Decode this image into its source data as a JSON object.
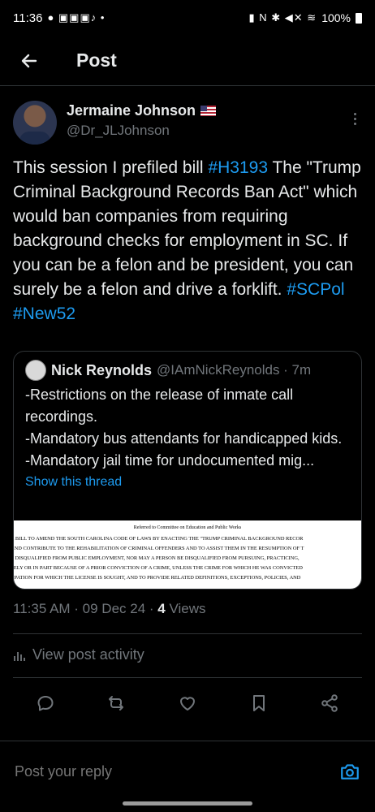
{
  "status_bar": {
    "time": "11:36",
    "notifications": "● ▣▣▣♪ •",
    "system_icons": "▮ N ✱ ◀✕ ≋",
    "battery": "100%"
  },
  "header": {
    "title": "Post"
  },
  "post": {
    "author_name": "Jermaine Johnson",
    "author_handle": "@Dr_JLJohnson",
    "text_part1": "This session I prefiled bill ",
    "hashtag1": "#H3193",
    "text_part2": " The \"Trump Criminal Background Records Ban Act\" which would ban companies from requiring background checks for employment in SC. If you can be a felon and be president, you can surely be a felon and drive a forklift. ",
    "hashtag2": "#SCPol",
    "hashtag3": "#New52",
    "timestamp": "11:35 AM · 09 Dec 24 · ",
    "views_count": "4",
    "views_label": " Views"
  },
  "quote": {
    "name": "Nick Reynolds",
    "handle": "@IAmNickReynolds · 7m",
    "text": "-Restrictions on the release of inmate call recordings.\n-Mandatory bus attendants for handicapped kids.\n-Mandatory jail time for undocumented mig...",
    "show_thread": "Show this thread",
    "doc_title": "Referred to Committee on Education and Public Works",
    "doc_lines": [
      "A BILL TO AMEND THE SOUTH CAROLINA CODE OF LAWS BY ENACTING THE \"TRUMP CRIMINAL BACKGROUND RECOR",
      "AND CONTRIBUTE TO THE REHABILITATION OF CRIMINAL OFFENDERS AND TO ASSIST THEM IN THE RESUMPTION OF T",
      "E DISQUALIFIED FROM PUBLIC EMPLOYMENT, NOR MAY A PERSON BE DISQUALIFIED FROM PURSUING, PRACTICING,",
      "LELY OR IN PART BECAUSE OF A PRIOR CONVICTION OF A CRIME, UNLESS THE CRIME FOR WHICH HE WAS CONVICTED",
      "UPATION FOR WHICH THE LICENSE IS SOUGHT, AND TO PROVIDE RELATED DEFINITIONS, EXCEPTIONS, POLICIES, AND"
    ]
  },
  "activity_label": "View post activity",
  "reply": {
    "placeholder": "Post your reply"
  },
  "colors": {
    "background": "#000000",
    "accent": "#1d9bf0",
    "muted": "#71767b",
    "divider": "#2f3336"
  }
}
